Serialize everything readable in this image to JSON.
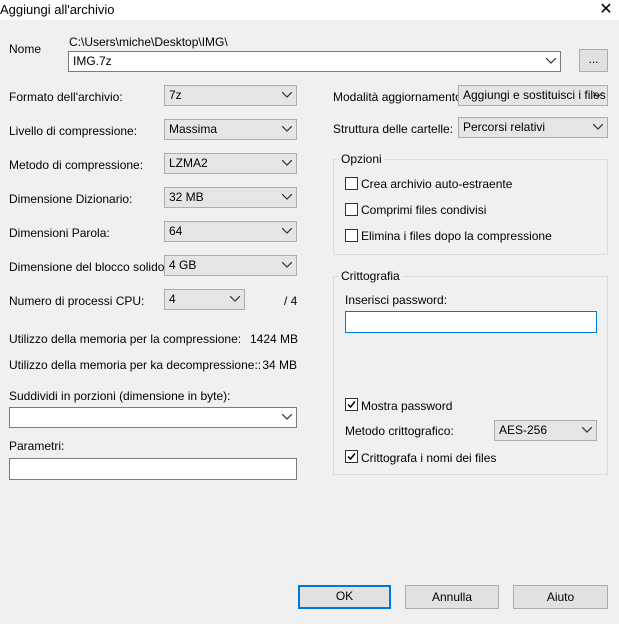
{
  "window": {
    "title": "Aggiungi all'archivio",
    "close_glyph": "✕"
  },
  "name": {
    "label": "Nome",
    "path": "C:\\Users\\miche\\Desktop\\IMG\\",
    "value": "IMG.7z",
    "browse_label": "..."
  },
  "left": {
    "format": {
      "label": "Formato dell'archivio:",
      "value": "7z"
    },
    "level": {
      "label": "Livello di compressione:",
      "value": "Massima"
    },
    "method": {
      "label": "Metodo di compressione:",
      "value": "LZMA2"
    },
    "dict": {
      "label": "Dimensione Dizionario:",
      "value": "32 MB"
    },
    "word": {
      "label": "Dimensioni Parola:",
      "value": "64"
    },
    "solid": {
      "label": "Dimensione del blocco solido:",
      "value": "4 GB"
    },
    "threads": {
      "label": "Numero di processi CPU:",
      "value": "4",
      "total": "/ 4"
    },
    "mem_comp": {
      "label": "Utilizzo della memoria per la compressione:",
      "value": "1424 MB"
    },
    "mem_decomp": {
      "label": "Utilizzo della memoria per ka decompressione::",
      "value": "34 MB"
    },
    "split": {
      "label": "Suddividi in porzioni (dimensione in byte):",
      "value": ""
    },
    "params": {
      "label": "Parametri:",
      "value": ""
    }
  },
  "right": {
    "update": {
      "label": "Modalità aggiornamento:",
      "value": "Aggiungi e sostituisci i files"
    },
    "paths": {
      "label": "Struttura delle cartelle:",
      "value": "Percorsi relativi"
    },
    "options": {
      "title": "Opzioni",
      "sfx": {
        "label": "Crea archivio auto-estraente",
        "checked": false
      },
      "shared": {
        "label": "Comprimi files condivisi",
        "checked": false
      },
      "delete": {
        "label": "Elimina i files dopo la compressione",
        "checked": false
      }
    },
    "encryption": {
      "title": "Crittografia",
      "password_label": "Inserisci password:",
      "password_value": "",
      "show_password": {
        "label": "Mostra password",
        "checked": true
      },
      "method_label": "Metodo crittografico:",
      "method_value": "AES-256",
      "encrypt_names": {
        "label": "Crittografa i nomi dei files",
        "checked": true
      }
    }
  },
  "buttons": {
    "ok": "OK",
    "cancel": "Annulla",
    "help": "Aiuto"
  }
}
